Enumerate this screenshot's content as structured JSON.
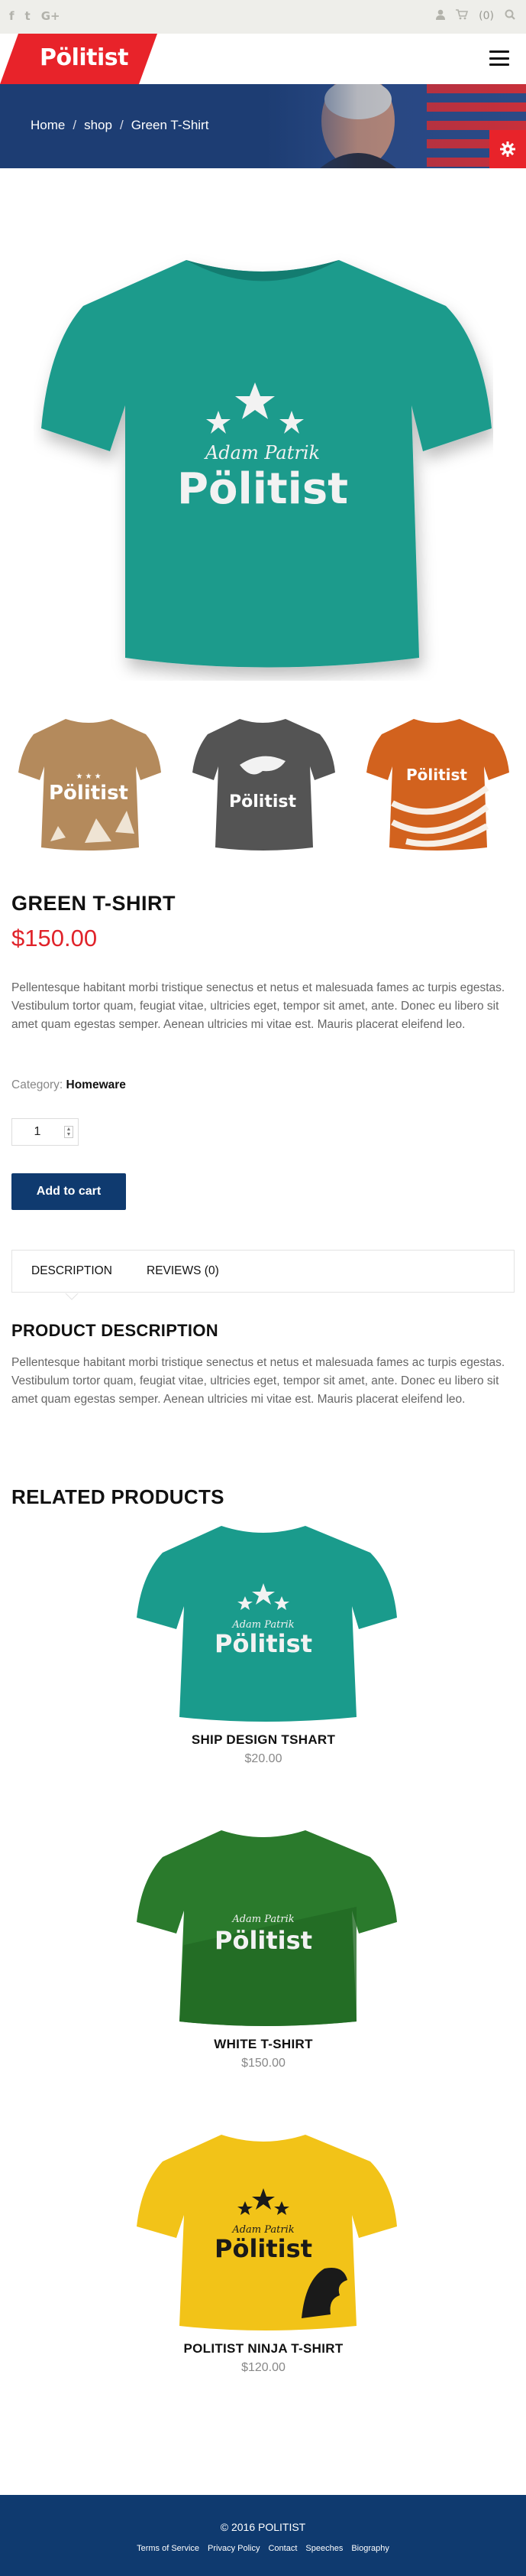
{
  "topbar": {
    "social_icons": [
      "facebook-icon",
      "twitter-icon",
      "google-plus-icon"
    ],
    "social_glyphs": [
      "f",
      "t",
      "G+"
    ],
    "cart_count": "(0)"
  },
  "header": {
    "logo": "Pölitist"
  },
  "breadcrumb": {
    "home": "Home",
    "sep": "/",
    "shop": "shop",
    "current": "Green T-Shirt"
  },
  "product": {
    "title": "GREEN T-SHIRT",
    "price": "$150.00",
    "description": "Pellentesque habitant morbi tristique senectus et netus et malesuada fames ac turpis egestas. Vestibulum tortor quam, feugiat vitae, ultricies eget, tempor sit amet, ante. Donec eu libero sit amet quam egestas semper. Aenean ultricies mi vitae est. Mauris placerat eleifend leo.",
    "category_label": "Category:",
    "category_value": "Homeware",
    "quantity": "1",
    "add_to_cart": "Add to cart",
    "shirt_brand_top": "Adam Patrik",
    "shirt_brand": "Pölitist"
  },
  "tabs": {
    "description": "DESCRIPTION",
    "reviews": "REVIEWS (0)"
  },
  "product_description": {
    "title": "PRODUCT DESCRIPTION",
    "text": "Pellentesque habitant morbi tristique senectus et netus et malesuada fames ac turpis egestas. Vestibulum tortor quam, feugiat vitae, ultricies eget, tempor sit amet, ante. Donec eu libero sit amet quam egestas semper. Aenean ultricies mi vitae est. Mauris placerat eleifend leo."
  },
  "related": {
    "title": "RELATED PRODUCTS",
    "items": [
      {
        "name": "SHIP DESIGN TSHART",
        "price": "$20.00",
        "color": "#1a9b8c"
      },
      {
        "name": "WHITE T-SHIRT",
        "price": "$150.00",
        "color": "#2a7a2c"
      },
      {
        "name": "POLITIST NINJA T-SHIRT",
        "price": "$120.00",
        "color": "#f2c318"
      }
    ]
  },
  "footer": {
    "copyright": "© 2016 POLITIST",
    "links": [
      "Terms of Service",
      "Privacy Policy",
      "Contact",
      "Speeches",
      "Biography"
    ]
  },
  "colors": {
    "accent_red": "#e8232a",
    "navy": "#0f3a6f",
    "teal_shirt": "#1a9b8c"
  }
}
